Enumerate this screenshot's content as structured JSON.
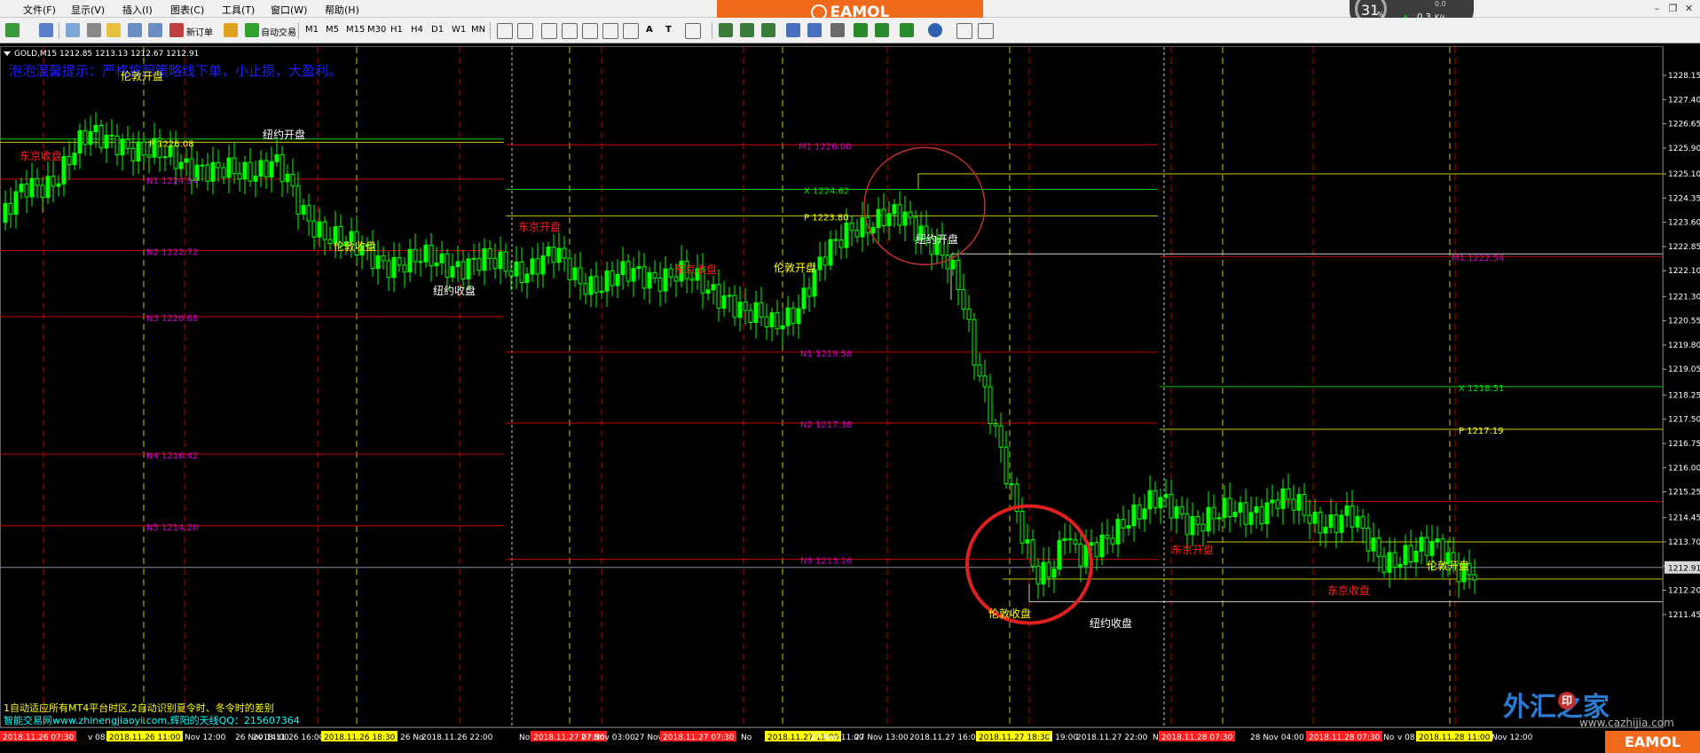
{
  "menu": [
    {
      "label": "文件(F)"
    },
    {
      "label": "显示(V)"
    },
    {
      "label": "插入(I)"
    },
    {
      "label": "图表(C)"
    },
    {
      "label": "工具(T)"
    },
    {
      "label": "窗口(W)"
    },
    {
      "label": "帮助(H)"
    }
  ],
  "brand": "EAMOL",
  "toolbar": {
    "new_order": "新订单",
    "auto_trade": "自动交易",
    "timeframes": [
      "M1",
      "M5",
      "M15",
      "M30",
      "H1",
      "H4",
      "D1",
      "W1",
      "MN"
    ],
    "text_tool": "A",
    "text_tool2": "T"
  },
  "gauge": {
    "percent": "31",
    "unit": "%",
    "speed": "0.3",
    "speed_unit": "K/s",
    "top": "0.0"
  },
  "chart": {
    "header": "GOLD,M15  1212.85 1213.13 1212.67 1212.91",
    "tip": "泡泡温馨提示：严格按照策略线下单，小止损，大盈利。",
    "footer_line1": "1自动适应所有MT4平台时区,2自动识别夏令时、冬令时的差别",
    "footer_line2": "智能交易网www.zhinengjiaoyi.com,辉阳的天线QQ：215607364",
    "current_price": "1212.91",
    "price_levels": [
      "1228.15",
      "1227.40",
      "1226.65",
      "1225.90",
      "1225.10",
      "1224.35",
      "1223.60",
      "1222.85",
      "1222.10",
      "1221.30",
      "1220.55",
      "1219.80",
      "1219.05",
      "1218.25",
      "1217.50",
      "1216.75",
      "1216.00",
      "1215.25",
      "1214.45",
      "1213.70",
      "1212.95",
      "1212.20",
      "1211.45"
    ],
    "session_labels": [
      {
        "text": "伦敦开盘"
      },
      {
        "text": "东京收盘"
      },
      {
        "text": "纽约开盘"
      },
      {
        "text": "伦敦收盘"
      },
      {
        "text": "纽约收盘"
      },
      {
        "text": "东京开盘"
      },
      {
        "text": "东京收盘"
      },
      {
        "text": "伦敦开盘"
      },
      {
        "text": "纽约开盘"
      },
      {
        "text": "伦敦收盘"
      },
      {
        "text": "纽约收盘"
      },
      {
        "text": "东京开盘"
      },
      {
        "text": "东京收盘"
      },
      {
        "text": "伦敦开盘"
      }
    ],
    "level_labels": [
      {
        "text": "P 1226.08"
      },
      {
        "text": "N1 1224.94"
      },
      {
        "text": "N2 1222.72"
      },
      {
        "text": "N3 1220.68"
      },
      {
        "text": "N4 1216.42"
      },
      {
        "text": "N5 1214.20"
      },
      {
        "text": "M1 1226.00"
      },
      {
        "text": "X 1224.62"
      },
      {
        "text": "P 1223.80"
      },
      {
        "text": "N1 1219.58"
      },
      {
        "text": "N2 1217.38"
      },
      {
        "text": "N3 1213.16"
      },
      {
        "text": "M1 1222.54"
      },
      {
        "text": "X 1218.51"
      },
      {
        "text": "P 1217.19"
      }
    ],
    "time_labels": [
      {
        "text": "2018.11.26 07:30"
      },
      {
        "text": "v 08:00"
      },
      {
        "text": "2018.11.26 11:00"
      },
      {
        "text": "Nov 12:00"
      },
      {
        "text": "26 Nov 14:00"
      },
      {
        "text": "2018.11.26 16:00"
      },
      {
        "text": "2018.11.26 18:30"
      },
      {
        "text": "26 No"
      },
      {
        "text": "2018.11.26 22:00"
      },
      {
        "text": "Nov"
      },
      {
        "text": "2018.11.27 07:30"
      },
      {
        "text": "27 Nov 03:00"
      },
      {
        "text": "27 Nov 0"
      },
      {
        "text": "2018.11.27 07:30"
      },
      {
        "text": "No"
      },
      {
        "text": "2018.11.27 11:00"
      },
      {
        "text": "27 Nov 11:00"
      },
      {
        "text": "27 Nov 13:00"
      },
      {
        "text": "2018.11.27 16:00"
      },
      {
        "text": "2018.11.27 18:30"
      },
      {
        "text": "v 19:00"
      },
      {
        "text": "2018.11.27 22:00"
      },
      {
        "text": "No"
      },
      {
        "text": "2018.11.28 07:30"
      },
      {
        "text": "28 Nov 04:00"
      },
      {
        "text": "2018.11.28 07:30"
      },
      {
        "text": "No"
      },
      {
        "text": "v 08:00"
      },
      {
        "text": "2018.11.28 11:00"
      },
      {
        "text": "Nov 12:00"
      }
    ]
  },
  "watermark": {
    "text": "外汇之家",
    "url": "www.cazhijia.com",
    "seal": "印"
  },
  "colors": {
    "bull": "#00ff00",
    "bear": "#000000",
    "red_line": "#c80000",
    "green_line": "#00c800",
    "yellow_line": "#c8c800",
    "session_red": "#ff1e1e",
    "session_yellow": "#ffff00",
    "tip_blue": "#1e1eff",
    "level_magenta": "#d800d8"
  }
}
